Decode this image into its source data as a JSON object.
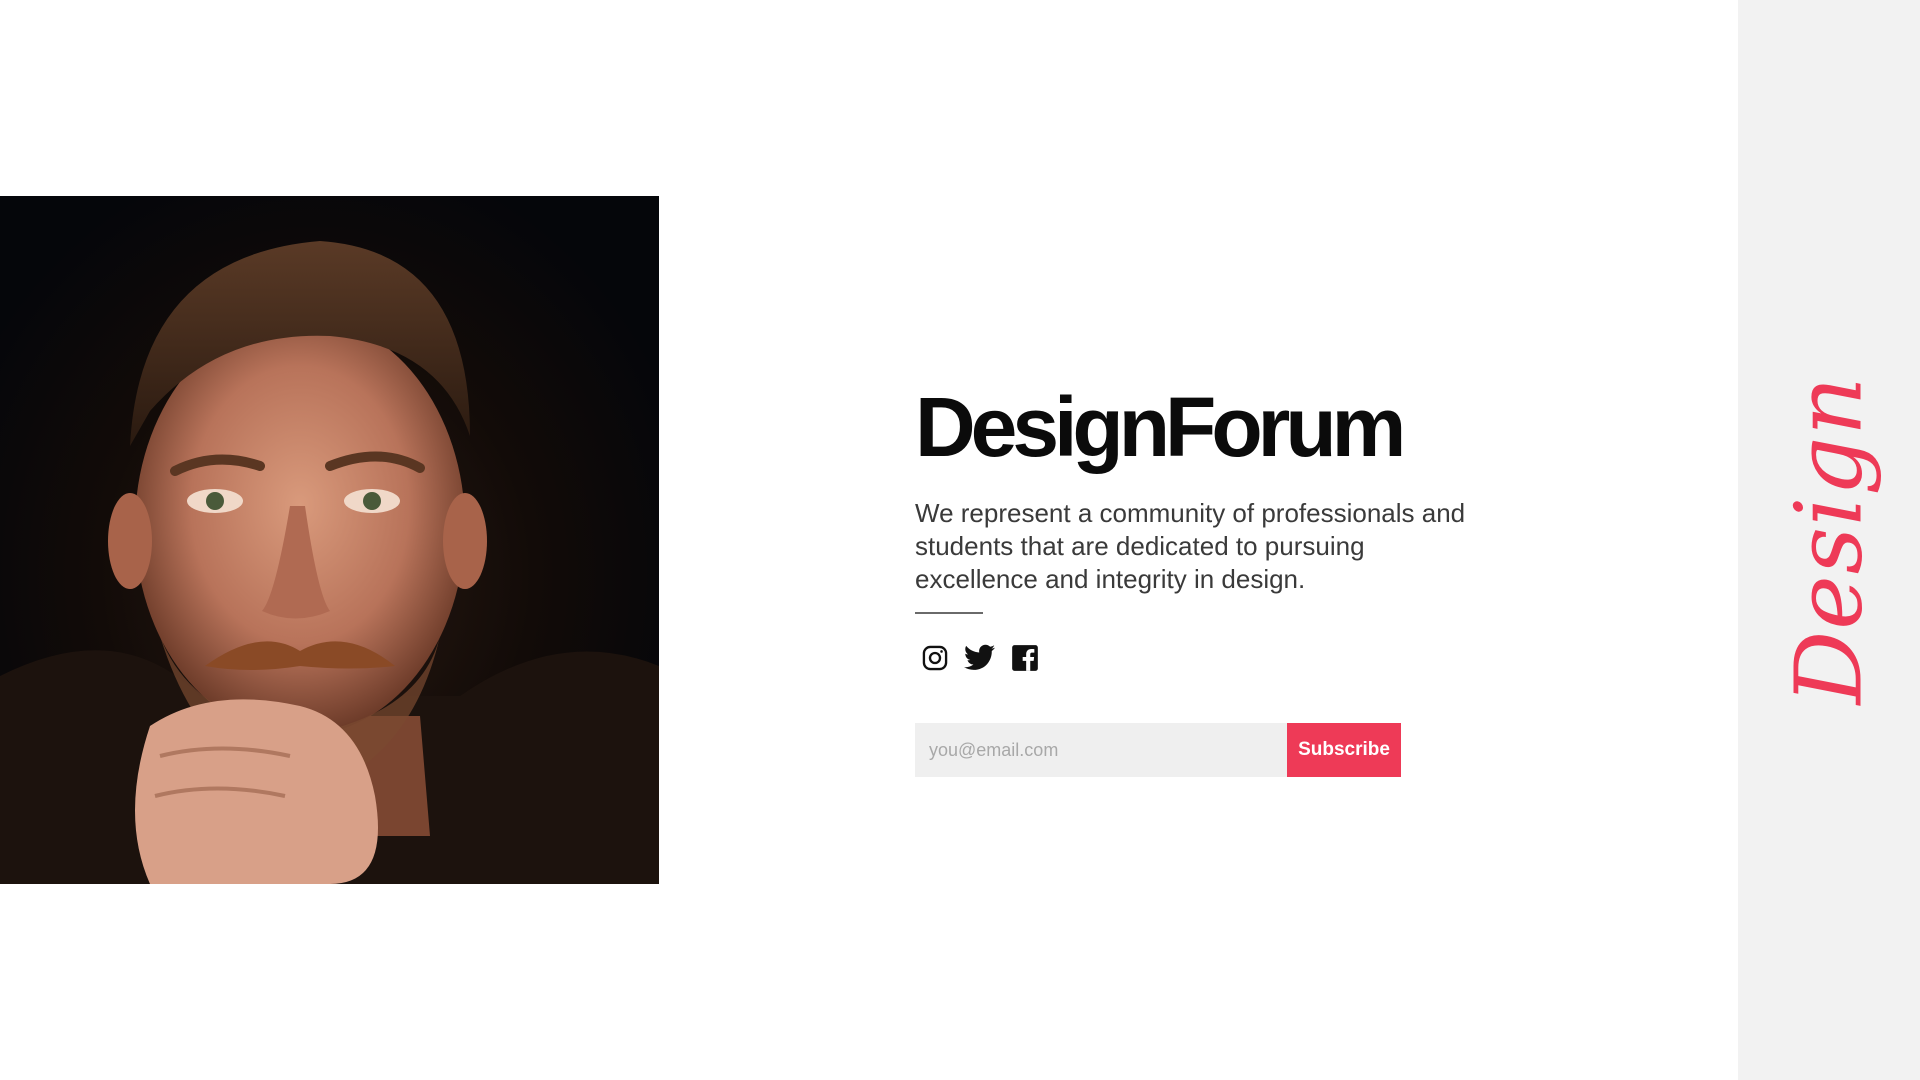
{
  "brand": {
    "title": "DesignForum",
    "accent_color": "#ee3a57"
  },
  "hero": {
    "description": "We represent a community of professionals and students that are dedicated to pursuing excellence and integrity in design.",
    "photo_alt": "Portrait photo"
  },
  "socials": [
    {
      "icon": "instagram-icon"
    },
    {
      "icon": "twitter-icon"
    },
    {
      "icon": "facebook-icon"
    }
  ],
  "subscribe": {
    "placeholder": "you@email.com",
    "button_label": "Subscribe"
  },
  "rail": {
    "word": "Design"
  }
}
